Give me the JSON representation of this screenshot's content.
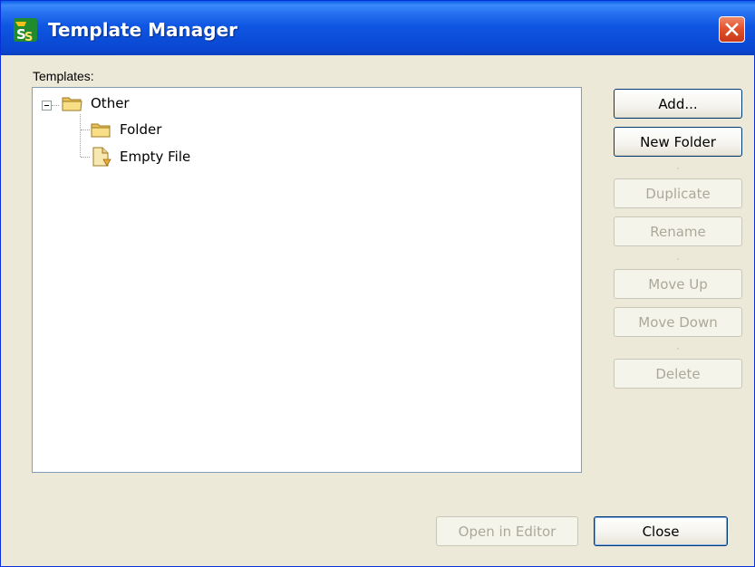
{
  "window": {
    "title": "Template Manager",
    "app_icon": "ss-app-icon",
    "close_icon": "close-icon"
  },
  "templates_label": "Templates:",
  "tree": {
    "root": {
      "label": "Other",
      "icon": "folder-open-icon",
      "expanded": true
    },
    "children": [
      {
        "label": "Folder",
        "icon": "folder-icon"
      },
      {
        "label": "Empty File",
        "icon": "file-icon"
      }
    ]
  },
  "buttons": {
    "add": "Add...",
    "new_folder": "New Folder",
    "duplicate": "Duplicate",
    "rename": "Rename",
    "move_up": "Move Up",
    "move_down": "Move Down",
    "delete": "Delete",
    "open_in_editor": "Open in Editor",
    "close": "Close"
  },
  "colors": {
    "titlebar": "#0A47D0",
    "dialog_bg": "#ECE9D8",
    "close_button": "#E2532E",
    "disabled_text": "#ACA899"
  }
}
